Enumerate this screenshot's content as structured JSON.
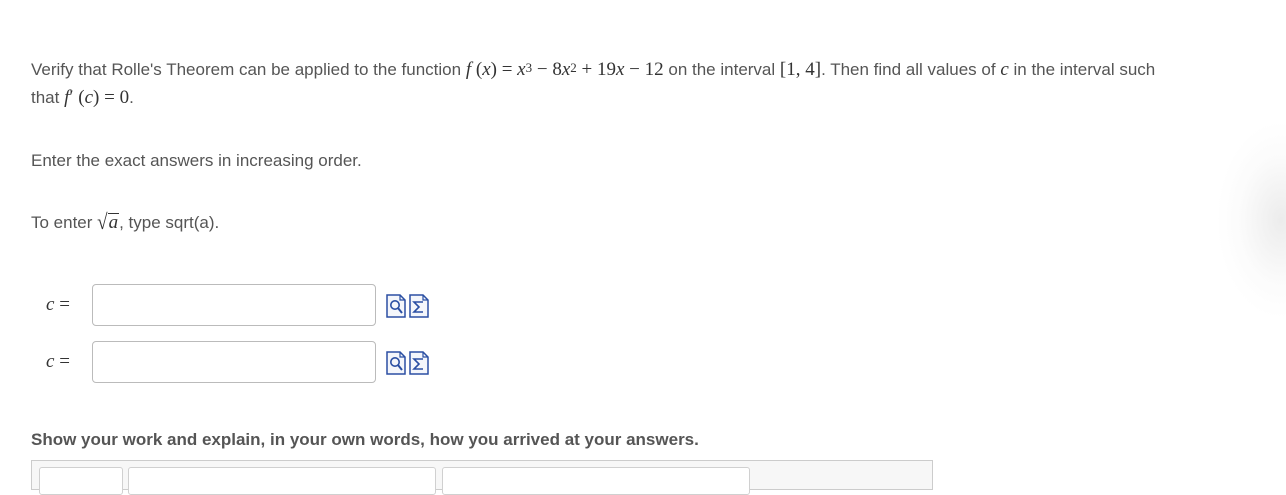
{
  "problem": {
    "intro": "Verify that Rolle's Theorem can be applied to the function",
    "function_math": "f (x) = x³ − 8x² + 19x − 12",
    "interval_lead": "on the interval",
    "interval_math": "[1, 4]",
    "then_text": ". Then find all values of",
    "c_var": "c",
    "in_interval_text": "in the interval such",
    "that_text": "that",
    "condition_math": "f′ (c) = 0",
    "period": "."
  },
  "instructions": {
    "order_text": "Enter the exact answers in increasing order.",
    "sqrt_prefix": "To enter",
    "sqrt_radicand": "a",
    "sqrt_suffix": ", type sqrt(a)."
  },
  "answers": [
    {
      "label_var": "c",
      "label_eq": "=",
      "value": "",
      "preview_icon": "preview-icon",
      "equation_icon": "equation-editor-icon"
    },
    {
      "label_var": "c",
      "label_eq": "=",
      "value": "",
      "preview_icon": "preview-icon",
      "equation_icon": "equation-editor-icon"
    }
  ],
  "show_work": {
    "label": "Show your work and explain, in your own words, how you arrived at your answers."
  },
  "colors": {
    "text": "#555555",
    "math": "#333333",
    "icon_blue": "#2b4fa3",
    "border": "#bbbbbb"
  }
}
